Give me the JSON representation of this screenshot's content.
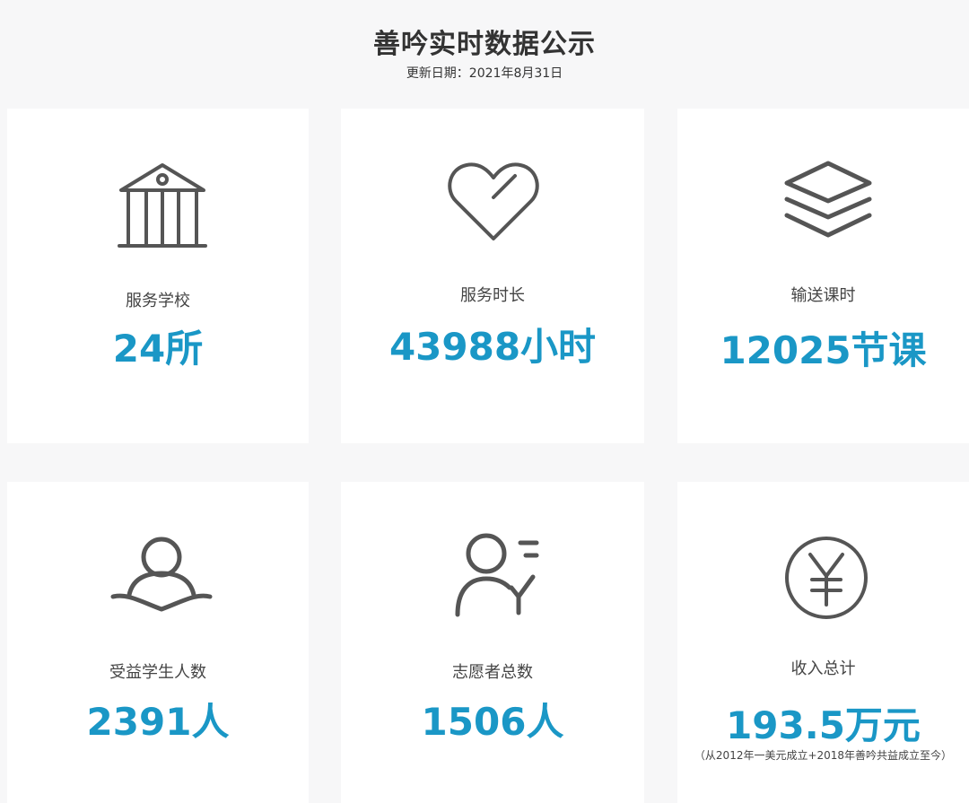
{
  "header": {
    "title": "善吟实时数据公示",
    "update_date": "更新日期：2021年8月31日"
  },
  "colors": {
    "accent": "#1a97c6",
    "icon": "#555555",
    "card_bg": "#ffffff",
    "page_bg": "#f7f7f8"
  },
  "stats": [
    {
      "icon": "bank-icon",
      "label": "服务学校",
      "value": "24所"
    },
    {
      "icon": "heart-icon",
      "label": "服务时长",
      "value": "43988小时"
    },
    {
      "icon": "layers-icon",
      "label": "输送课时",
      "value": "12025节课"
    },
    {
      "icon": "student-icon",
      "label": "受益学生人数",
      "value": "2391人"
    },
    {
      "icon": "volunteer-icon",
      "label": "志愿者总数",
      "value": "1506人"
    },
    {
      "icon": "yuan-icon",
      "label": "收入总计",
      "value": "193.5万元",
      "note": "（从2012年一美元成立+2018年善吟共益成立至今）"
    }
  ]
}
